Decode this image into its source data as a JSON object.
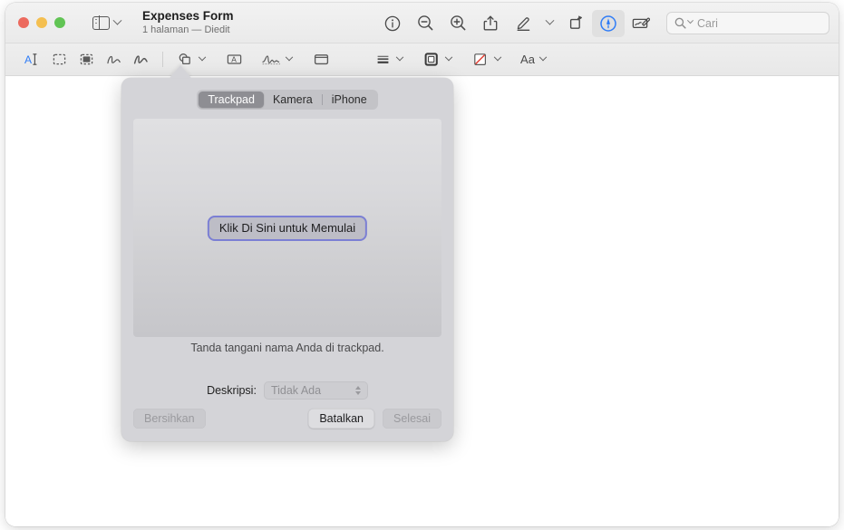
{
  "window": {
    "title": "Expenses Form",
    "subtitle": "1 halaman — Diedit",
    "traffic_lights": [
      {
        "name": "close",
        "color": "#ec6a5e"
      },
      {
        "name": "minimize",
        "color": "#f4bf50"
      },
      {
        "name": "zoom",
        "color": "#61c454"
      }
    ]
  },
  "toolbar": {
    "sidebar_button": "sidebar-toggle",
    "items": [
      {
        "name": "info-icon",
        "label": "Info"
      },
      {
        "name": "zoom-out-icon",
        "label": "Perkecil"
      },
      {
        "name": "zoom-in-icon",
        "label": "Perbesar"
      },
      {
        "name": "share-icon",
        "label": "Bagikan"
      },
      {
        "name": "highlight-pen-icon",
        "label": "Sorot"
      },
      {
        "name": "rotate-icon",
        "label": "Putar"
      },
      {
        "name": "markup-icon",
        "label": "Markah",
        "selected": true
      },
      {
        "name": "signature-pad-icon",
        "label": "Tanda Tangan"
      }
    ],
    "search": {
      "placeholder": "Cari",
      "value": ""
    }
  },
  "markup_toolbar": {
    "tools": [
      {
        "name": "text-selection-tool",
        "label": "Pilihan Teks",
        "selected": true
      },
      {
        "name": "rectangular-selection-tool",
        "label": "Pilihan Persegi"
      },
      {
        "name": "instant-alpha-tool",
        "label": "Alfa Instan"
      },
      {
        "name": "sketch-tool",
        "label": "Sketsa"
      },
      {
        "name": "draw-tool",
        "label": "Gambar"
      },
      {
        "name": "shapes-tool",
        "label": "Bentuk"
      },
      {
        "name": "text-tool",
        "label": "Teks"
      },
      {
        "name": "signature-tool",
        "label": "Tanda Tangan"
      },
      {
        "name": "note-tool",
        "label": "Catatan"
      },
      {
        "name": "shape-style-tool",
        "label": "Gaya Bentuk"
      },
      {
        "name": "border-color-tool",
        "label": "Warna Batas"
      },
      {
        "name": "fill-color-tool",
        "label": "Warna Isian"
      },
      {
        "name": "text-style-tool",
        "label": "Aa"
      }
    ],
    "text_style_label": "Aa"
  },
  "signature_popover": {
    "segments": [
      {
        "label": "Trackpad",
        "selected": true
      },
      {
        "label": "Kamera",
        "selected": false
      },
      {
        "label": "iPhone",
        "selected": false
      }
    ],
    "start_button": "Klik Di Sini untuk Memulai",
    "hint": "Tanda tangani nama Anda di trackpad.",
    "description_label": "Deskripsi:",
    "description_value": "Tidak Ada",
    "buttons": {
      "clear": "Bersihkan",
      "cancel": "Batalkan",
      "done": "Selesai"
    }
  },
  "colors": {
    "accent": "#3b7ff5",
    "start_button_border": "#7b7fd4",
    "popover_bg": "#d4d4d8"
  }
}
